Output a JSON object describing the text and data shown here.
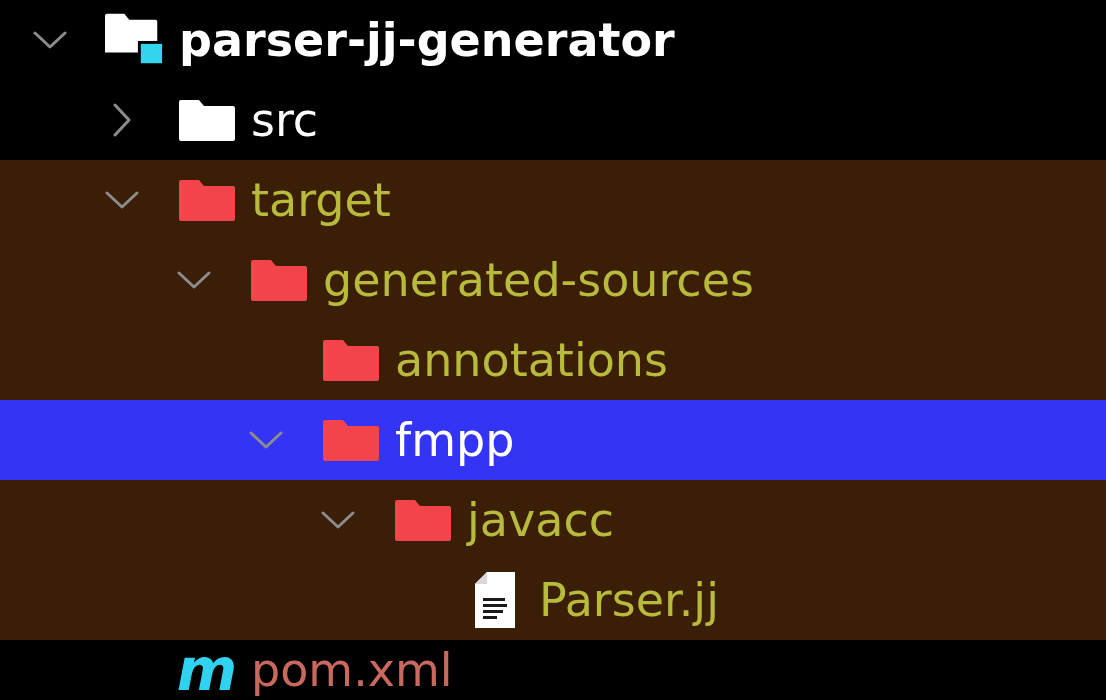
{
  "project_tree": {
    "items": [
      {
        "name": "parser-jj-generator",
        "kind": "module",
        "expanded": true,
        "selected": false,
        "excluded": false,
        "children": [
          {
            "name": "src",
            "kind": "folder",
            "expanded": false,
            "selected": false,
            "excluded": false
          },
          {
            "name": "target",
            "kind": "folder",
            "expanded": true,
            "selected": false,
            "excluded": true,
            "children": [
              {
                "name": "generated-sources",
                "kind": "folder",
                "expanded": true,
                "selected": false,
                "excluded": true,
                "children": [
                  {
                    "name": "annotations",
                    "kind": "folder",
                    "selected": false,
                    "excluded": true
                  },
                  {
                    "name": "fmpp",
                    "kind": "folder",
                    "expanded": true,
                    "selected": true,
                    "excluded": true,
                    "children": [
                      {
                        "name": "javacc",
                        "kind": "folder",
                        "expanded": true,
                        "selected": false,
                        "excluded": true,
                        "children": [
                          {
                            "name": "Parser.jj",
                            "kind": "file",
                            "selected": false,
                            "excluded": true
                          }
                        ]
                      }
                    ]
                  }
                ]
              }
            ]
          },
          {
            "name": "pom.xml",
            "kind": "maven",
            "icon_text": "m",
            "selected": false,
            "excluded": false,
            "color": "#c9695d"
          }
        ]
      }
    ]
  }
}
